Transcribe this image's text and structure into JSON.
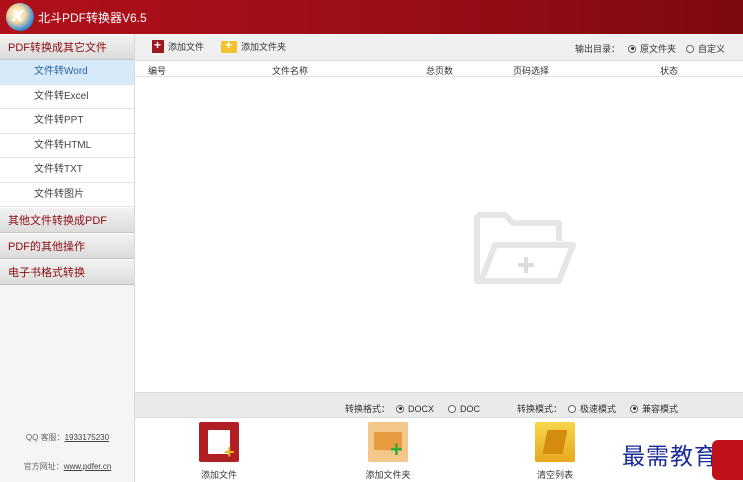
{
  "app": {
    "title": "北斗PDF转换器V6.5",
    "logo_glyph": "X"
  },
  "sidebar": {
    "categories": [
      {
        "label": "PDF转换成其它文件",
        "items": [
          "文件转Word",
          "文件转Excel",
          "文件转PPT",
          "文件转HTML",
          "文件转TXT",
          "文件转图片"
        ],
        "active_index": 0
      },
      {
        "label": "其他文件转换成PDF"
      },
      {
        "label": "PDF的其他操作"
      },
      {
        "label": "电子书格式转换"
      }
    ],
    "qq_label": "QQ 客服：",
    "qq_number": "1933175230",
    "site_label": "官方网址：",
    "site_url": "www.pdfer.cn"
  },
  "toolbar": {
    "add_file": "添加文件",
    "add_folder": "添加文件夹",
    "output_label": "输出目录：",
    "output_options": [
      "原文件夹",
      "自定义"
    ],
    "output_selected": "原文件夹"
  },
  "table": {
    "columns": [
      "编号",
      "文件名称",
      "总页数",
      "页码选择",
      "状态"
    ],
    "rows": []
  },
  "statusbar": {
    "format_label": "转换格式：",
    "format_options": [
      "DOCX",
      "DOC"
    ],
    "format_selected": "DOCX",
    "mode_label": "转换模式：",
    "mode_options": [
      "极速模式",
      "兼容模式"
    ],
    "mode_selected": "兼容模式"
  },
  "bottom": {
    "add_file": "添加文件",
    "add_folder": "添加文件夹",
    "clear_list": "清空列表"
  },
  "watermark": "最需教育",
  "colors": {
    "brand": "#9a0d16",
    "active_item_bg": "#d6eaf9",
    "category_text": "#8a0c12"
  }
}
